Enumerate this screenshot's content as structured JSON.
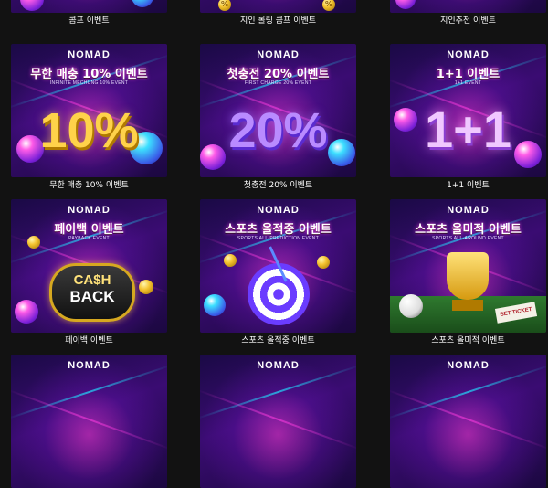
{
  "brand": {
    "logo": "NOMAD"
  },
  "events": [
    {
      "id": "row0-col0",
      "label": "콤프 이벤트"
    },
    {
      "id": "row0-col1",
      "label": "지인 롤링 콤프 이벤트",
      "banner_badges": [
        "%",
        "%"
      ]
    },
    {
      "id": "row0-col2",
      "label": "지인추천 이벤트"
    },
    {
      "id": "row1-col0",
      "label": "무한 매충 10% 이벤트",
      "banner_title": "무한 매충 10% 이벤트",
      "banner_sub": "INFINITE MECHUNG 10% EVENT",
      "banner_big": "10%"
    },
    {
      "id": "row1-col1",
      "label": "첫충전 20% 이벤트",
      "banner_title": "첫충전 20% 이벤트",
      "banner_sub": "FIRST CHARGE 20% EVENT",
      "banner_big": "20%"
    },
    {
      "id": "row1-col2",
      "label": "1+1 이벤트",
      "banner_title": "1+1 이벤트",
      "banner_sub": "1+1 EVENT",
      "banner_big": "1+1"
    },
    {
      "id": "row2-col0",
      "label": "페이백 이벤트",
      "banner_title": "페이백 이벤트",
      "banner_sub": "PAYBACK EVENT",
      "banner_big_l1": "CA$H",
      "banner_big_l2": "BACK"
    },
    {
      "id": "row2-col1",
      "label": "스포츠 올적중 이벤트",
      "banner_title": "스포츠 올적중 이벤트",
      "banner_sub": "SPORTS ALL-PREDICTION EVENT"
    },
    {
      "id": "row2-col2",
      "label": "스포츠 올미적 이벤트",
      "banner_title": "스포츠 올미적 이벤트",
      "banner_sub": "SPORTS ALL-AROUND EVENT",
      "banner_tag": "BET TICKET"
    }
  ],
  "colors": {
    "page_bg": "#121212",
    "neon_pink": "#ff3ce0",
    "neon_cyan": "#20e0ff",
    "gold": "#ffd24a",
    "violet": "#b98bff"
  }
}
